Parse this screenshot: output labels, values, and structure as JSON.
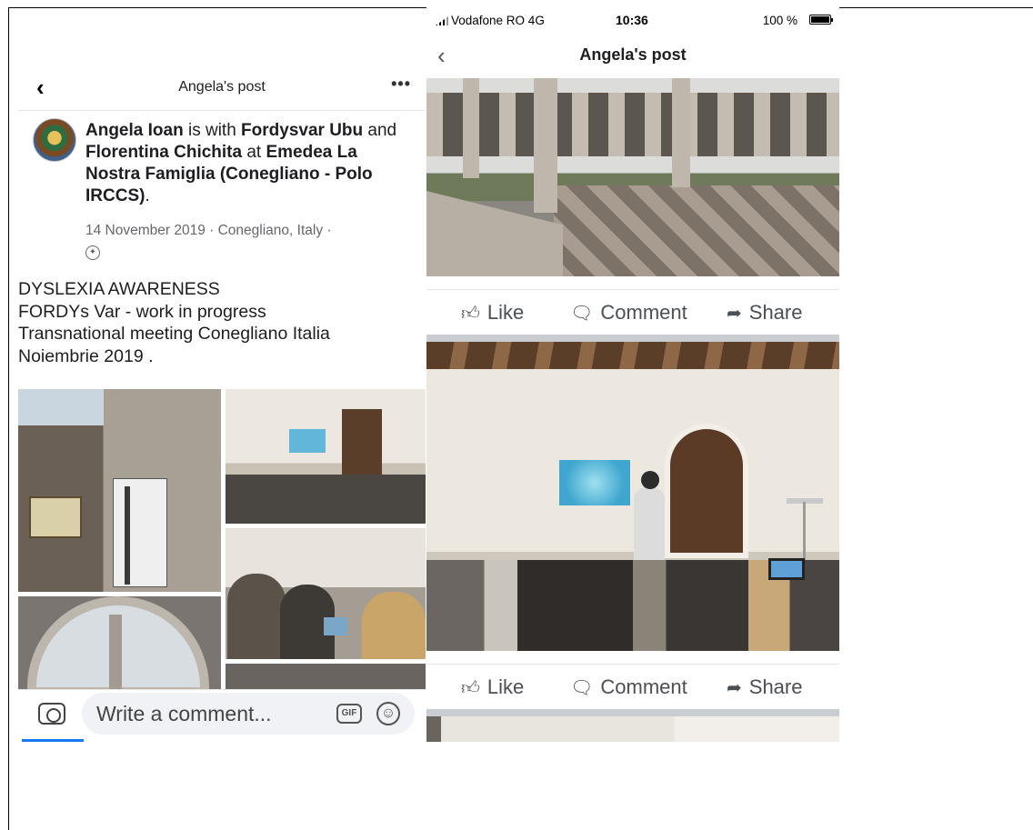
{
  "left": {
    "nav": {
      "back_glyph": "‹",
      "title": "Angela's post",
      "more_glyph": "•••"
    },
    "header": {
      "author": "Angela Ioan",
      "is_with": " is with ",
      "friend1": "Fordysvar Ubu",
      "and": " and ",
      "friend2": "Florentina Chichita",
      "at": " at ",
      "place": "Emedea  La Nostra Famiglia (Conegliano - Polo IRCCS)",
      "period": ".",
      "meta": "14 November 2019 · Conegliano, Italy ·",
      "privacy_icon": "globe-icon"
    },
    "body_lines": [
      "DYSLEXIA AWARENESS",
      "FORDYs Var - work in progress",
      "Transnational meeting Conegliano Italia",
      "Noiembrie 2019 ."
    ],
    "comment_bar": {
      "placeholder": "Write a comment...",
      "gif_label": "GIF",
      "camera_icon": "camera-icon",
      "emoji_icon": "emoji-icon"
    }
  },
  "right": {
    "status_bar": {
      "carrier": "Vodafone RO  4G",
      "time": "10:36",
      "battery": "100 %"
    },
    "nav": {
      "back_glyph": "‹",
      "title": "Angela's post"
    },
    "actions": [
      {
        "like": "Like",
        "comment": "Comment",
        "share": "Share"
      },
      {
        "like": "Like",
        "comment": "Comment",
        "share": "Share"
      }
    ]
  },
  "colors": {
    "text": "#1c1e21",
    "secondary_text": "#65676b",
    "accent": "#1877f2",
    "separator": "#c9ccd1"
  }
}
